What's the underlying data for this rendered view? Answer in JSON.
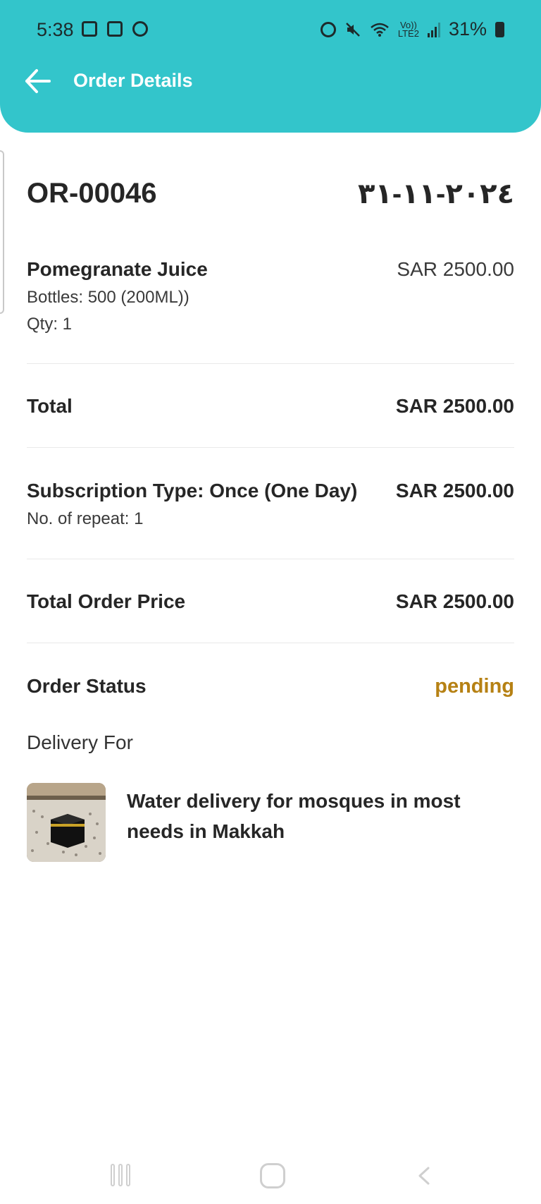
{
  "status_bar": {
    "time": "5:38",
    "volte": "Vo))",
    "lte": "LTE2",
    "battery": "31%",
    "icons": [
      "gallery-icon",
      "screen-record-icon",
      "samsung-icon",
      "alarm-icon",
      "mute-icon",
      "wifi-icon",
      "signal-icon",
      "battery-icon"
    ]
  },
  "header": {
    "title": "Order Details",
    "background_color": "#33c5cb",
    "back_icon": "arrow-left-icon"
  },
  "order": {
    "id": "OR-00046",
    "date": "٢٠٢٤-١١-٣١"
  },
  "item": {
    "name": "Pomegranate Juice",
    "detail": "Bottles: 500 (200ML))",
    "qty": "Qty: 1",
    "price": "SAR 2500.00"
  },
  "total": {
    "label": "Total",
    "value": "SAR 2500.00"
  },
  "subscription": {
    "label": "Subscription Type: Once (One Day)",
    "repeat": "No. of repeat: 1",
    "value": "SAR 2500.00"
  },
  "total_order_price": {
    "label": "Total Order Price",
    "value": "SAR 2500.00"
  },
  "order_status": {
    "label": "Order Status",
    "value": "pending",
    "color": "#b68114"
  },
  "delivery": {
    "label": "Delivery For",
    "campaign_title": "Water delivery for mosques in most needs in Makkah"
  },
  "nav_bar": {
    "icons": [
      "recent-apps-icon",
      "home-icon",
      "back-icon"
    ]
  }
}
